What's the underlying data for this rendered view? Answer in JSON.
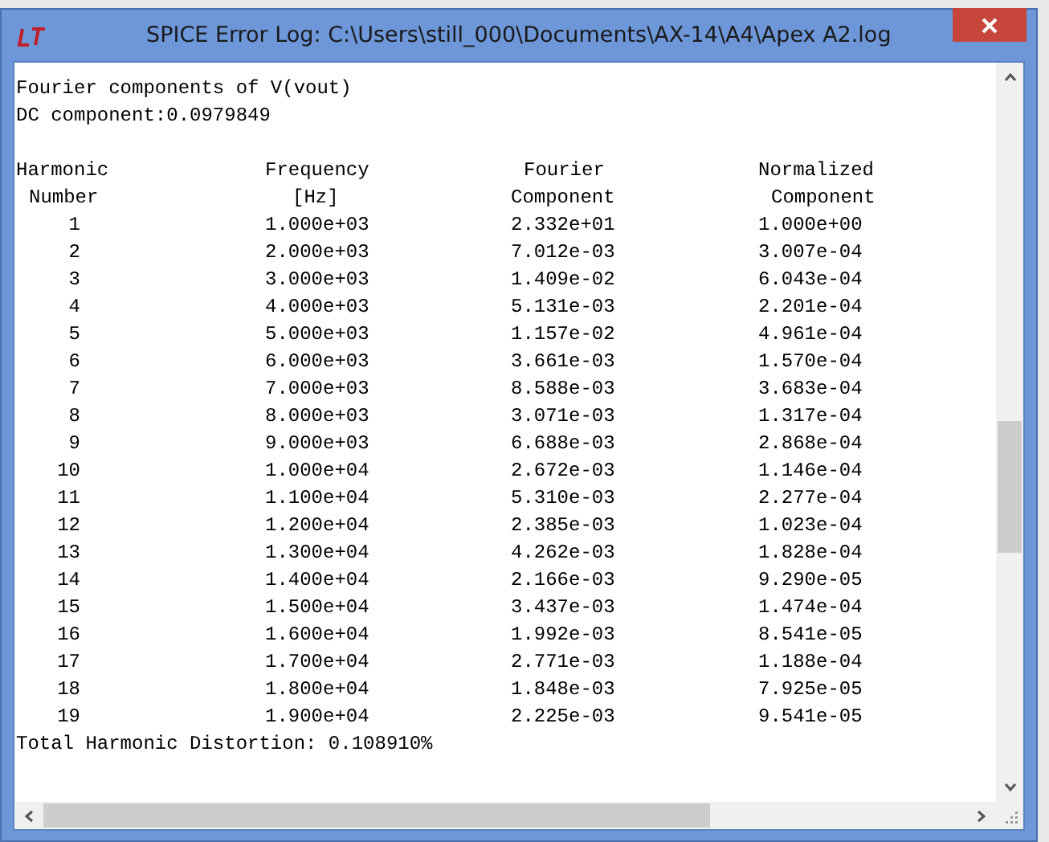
{
  "window": {
    "title": "SPICE Error Log: C:\\Users\\still_000\\Documents\\AX-14\\A4\\Apex A2.log"
  },
  "log": {
    "lines": [
      "Fourier components of V(vout)",
      "DC component:0.0979849"
    ],
    "table": {
      "columns": [
        {
          "heading": "Harmonic",
          "subheading": "Number"
        },
        {
          "heading": "Frequency",
          "subheading": "[Hz]"
        },
        {
          "heading": "Fourier",
          "subheading": "Component"
        },
        {
          "heading": "Normalized",
          "subheading": "Component"
        }
      ],
      "rows": [
        [
          "1",
          "1.000e+03",
          "2.332e+01",
          "1.000e+00"
        ],
        [
          "2",
          "2.000e+03",
          "7.012e-03",
          "3.007e-04"
        ],
        [
          "3",
          "3.000e+03",
          "1.409e-02",
          "6.043e-04"
        ],
        [
          "4",
          "4.000e+03",
          "5.131e-03",
          "2.201e-04"
        ],
        [
          "5",
          "5.000e+03",
          "1.157e-02",
          "4.961e-04"
        ],
        [
          "6",
          "6.000e+03",
          "3.661e-03",
          "1.570e-04"
        ],
        [
          "7",
          "7.000e+03",
          "8.588e-03",
          "3.683e-04"
        ],
        [
          "8",
          "8.000e+03",
          "3.071e-03",
          "1.317e-04"
        ],
        [
          "9",
          "9.000e+03",
          "6.688e-03",
          "2.868e-04"
        ],
        [
          "10",
          "1.000e+04",
          "2.672e-03",
          "1.146e-04"
        ],
        [
          "11",
          "1.100e+04",
          "5.310e-03",
          "2.277e-04"
        ],
        [
          "12",
          "1.200e+04",
          "2.385e-03",
          "1.023e-04"
        ],
        [
          "13",
          "1.300e+04",
          "4.262e-03",
          "1.828e-04"
        ],
        [
          "14",
          "1.400e+04",
          "2.166e-03",
          "9.290e-05"
        ],
        [
          "15",
          "1.500e+04",
          "3.437e-03",
          "1.474e-04"
        ],
        [
          "16",
          "1.600e+04",
          "1.992e-03",
          "8.541e-05"
        ],
        [
          "17",
          "1.700e+04",
          "2.771e-03",
          "1.188e-04"
        ],
        [
          "18",
          "1.800e+04",
          "1.848e-03",
          "7.925e-05"
        ],
        [
          "19",
          "1.900e+04",
          "2.225e-03",
          "9.541e-05"
        ]
      ]
    },
    "summary": "Total Harmonic Distortion: 0.108910%"
  }
}
